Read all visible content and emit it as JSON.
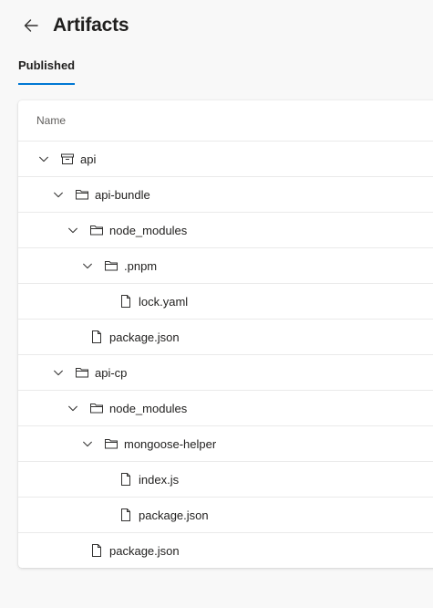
{
  "header": {
    "title": "Artifacts",
    "back_icon": "arrow-left-icon"
  },
  "tabs": [
    {
      "label": "Published",
      "selected": true
    }
  ],
  "accent_color": "#0078d4",
  "table": {
    "column_header": "Name",
    "rows": [
      {
        "label": "api",
        "depth": 0,
        "type": "artifact",
        "expanded": true
      },
      {
        "label": "api-bundle",
        "depth": 1,
        "type": "folder",
        "expanded": true
      },
      {
        "label": "node_modules",
        "depth": 2,
        "type": "folder",
        "expanded": true
      },
      {
        "label": ".pnpm",
        "depth": 3,
        "type": "folder",
        "expanded": true
      },
      {
        "label": "lock.yaml",
        "depth": 4,
        "type": "file"
      },
      {
        "label": "package.json",
        "depth": 2,
        "type": "file"
      },
      {
        "label": "api-cp",
        "depth": 1,
        "type": "folder",
        "expanded": true
      },
      {
        "label": "node_modules",
        "depth": 2,
        "type": "folder",
        "expanded": true
      },
      {
        "label": "mongoose-helper",
        "depth": 3,
        "type": "folder",
        "expanded": true
      },
      {
        "label": "index.js",
        "depth": 4,
        "type": "file"
      },
      {
        "label": "package.json",
        "depth": 4,
        "type": "file"
      },
      {
        "label": "package.json",
        "depth": 2,
        "type": "file"
      }
    ]
  }
}
